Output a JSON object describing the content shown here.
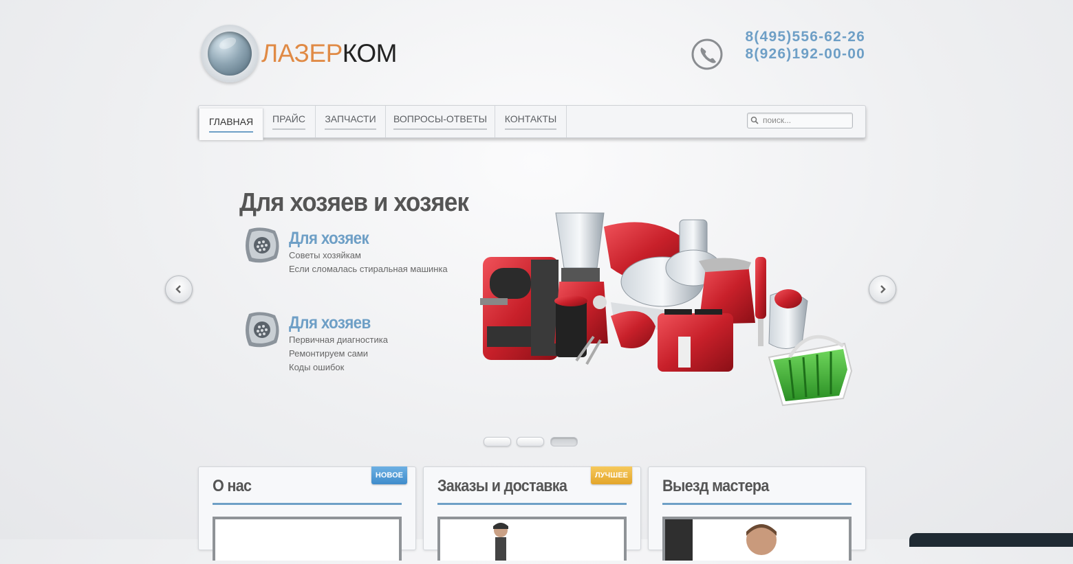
{
  "logo": {
    "part1": "ЛАЗЕР",
    "part2": "КОМ"
  },
  "phones": [
    "8(495)556-62-26",
    "8(926)192-00-00"
  ],
  "nav": {
    "items": [
      {
        "label": "ГЛАВНАЯ",
        "active": true
      },
      {
        "label": "ПРАЙС"
      },
      {
        "label": "ЗАПЧАСТИ"
      },
      {
        "label": "ВОПРОСЫ-ОТВЕТЫ"
      },
      {
        "label": "КОНТАКТЫ"
      }
    ],
    "search_placeholder": "поиск..."
  },
  "slider": {
    "title": "Для хозяев и хозяек",
    "features": [
      {
        "heading": "Для хозяек",
        "lines": [
          "Советы хозяйкам",
          "Если сломалась стиральная машинка"
        ]
      },
      {
        "heading": "Для хозяев",
        "lines": [
          "Первичная диагностика",
          "Ремонтируем сами",
          "Коды ошибок"
        ]
      }
    ],
    "active_dot": 3,
    "dot_count": 3
  },
  "boxes": [
    {
      "title": "О нас",
      "ribbon": "НОВОЕ",
      "ribbon_color": "#4a97d4"
    },
    {
      "title": "Заказы и доставка",
      "ribbon": "ЛУЧШЕЕ",
      "ribbon_color": "#eab23c"
    },
    {
      "title": "Выезд мастера"
    }
  ],
  "colors": {
    "accent": "#6e9fc6",
    "logo_orange": "#e08a45",
    "appliance_red": "#c8202a",
    "basket_green": "#3aaa35"
  }
}
